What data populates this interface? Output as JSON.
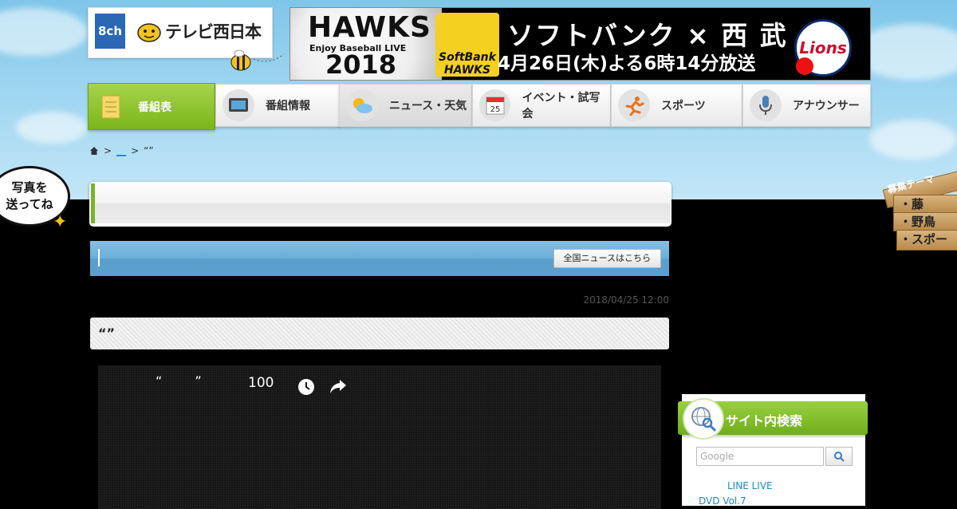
{
  "logo": {
    "channel": "8ch",
    "name": "テレビ西日本"
  },
  "banner": {
    "hawks": "HAWKS",
    "enjoy": "Enjoy Baseball LIVE",
    "year": "2018",
    "sponsor": "SoftBank HAWKS",
    "matchup": "ソフトバンク × 西 武",
    "date": "4月26日(木)よる6時14分放送",
    "opponent": "Lions"
  },
  "nav": {
    "items": [
      {
        "label": "番組表",
        "icon": "schedule-icon"
      },
      {
        "label": "番組情報",
        "icon": "tv-icon"
      },
      {
        "label": "ニュース・天気",
        "icon": "weather-icon"
      },
      {
        "label": "イベント・試写会",
        "icon": "calendar-icon",
        "icon_text": "25"
      },
      {
        "label": "スポーツ",
        "icon": "runner-icon"
      },
      {
        "label": "アナウンサー",
        "icon": "microphone-icon"
      }
    ]
  },
  "breadcrumb": {
    "sep1": ">",
    "link": "__",
    "sep2": ">",
    "current": "“”"
  },
  "bubble": {
    "line1": "写真を",
    "line2": "送ってね"
  },
  "news": {
    "button_label": "全国ニュースはこちら"
  },
  "article": {
    "timestamp": "2018/04/25 12:00",
    "title": "“”"
  },
  "video": {
    "quotes": "“ ”",
    "count": "100"
  },
  "sidebar": {
    "search_title": "サイト内検索",
    "search_placeholder": "Google",
    "link1": "LINE LIVE",
    "link2": "DVD Vol.7"
  },
  "theme_board": {
    "title": "募集テーマ",
    "items": [
      "・藤",
      "・野鳥",
      "・スポー"
    ]
  },
  "colors": {
    "accent_green": "#7bb51c",
    "news_blue": "#6aaed9",
    "link_blue": "#1a8ac8"
  }
}
